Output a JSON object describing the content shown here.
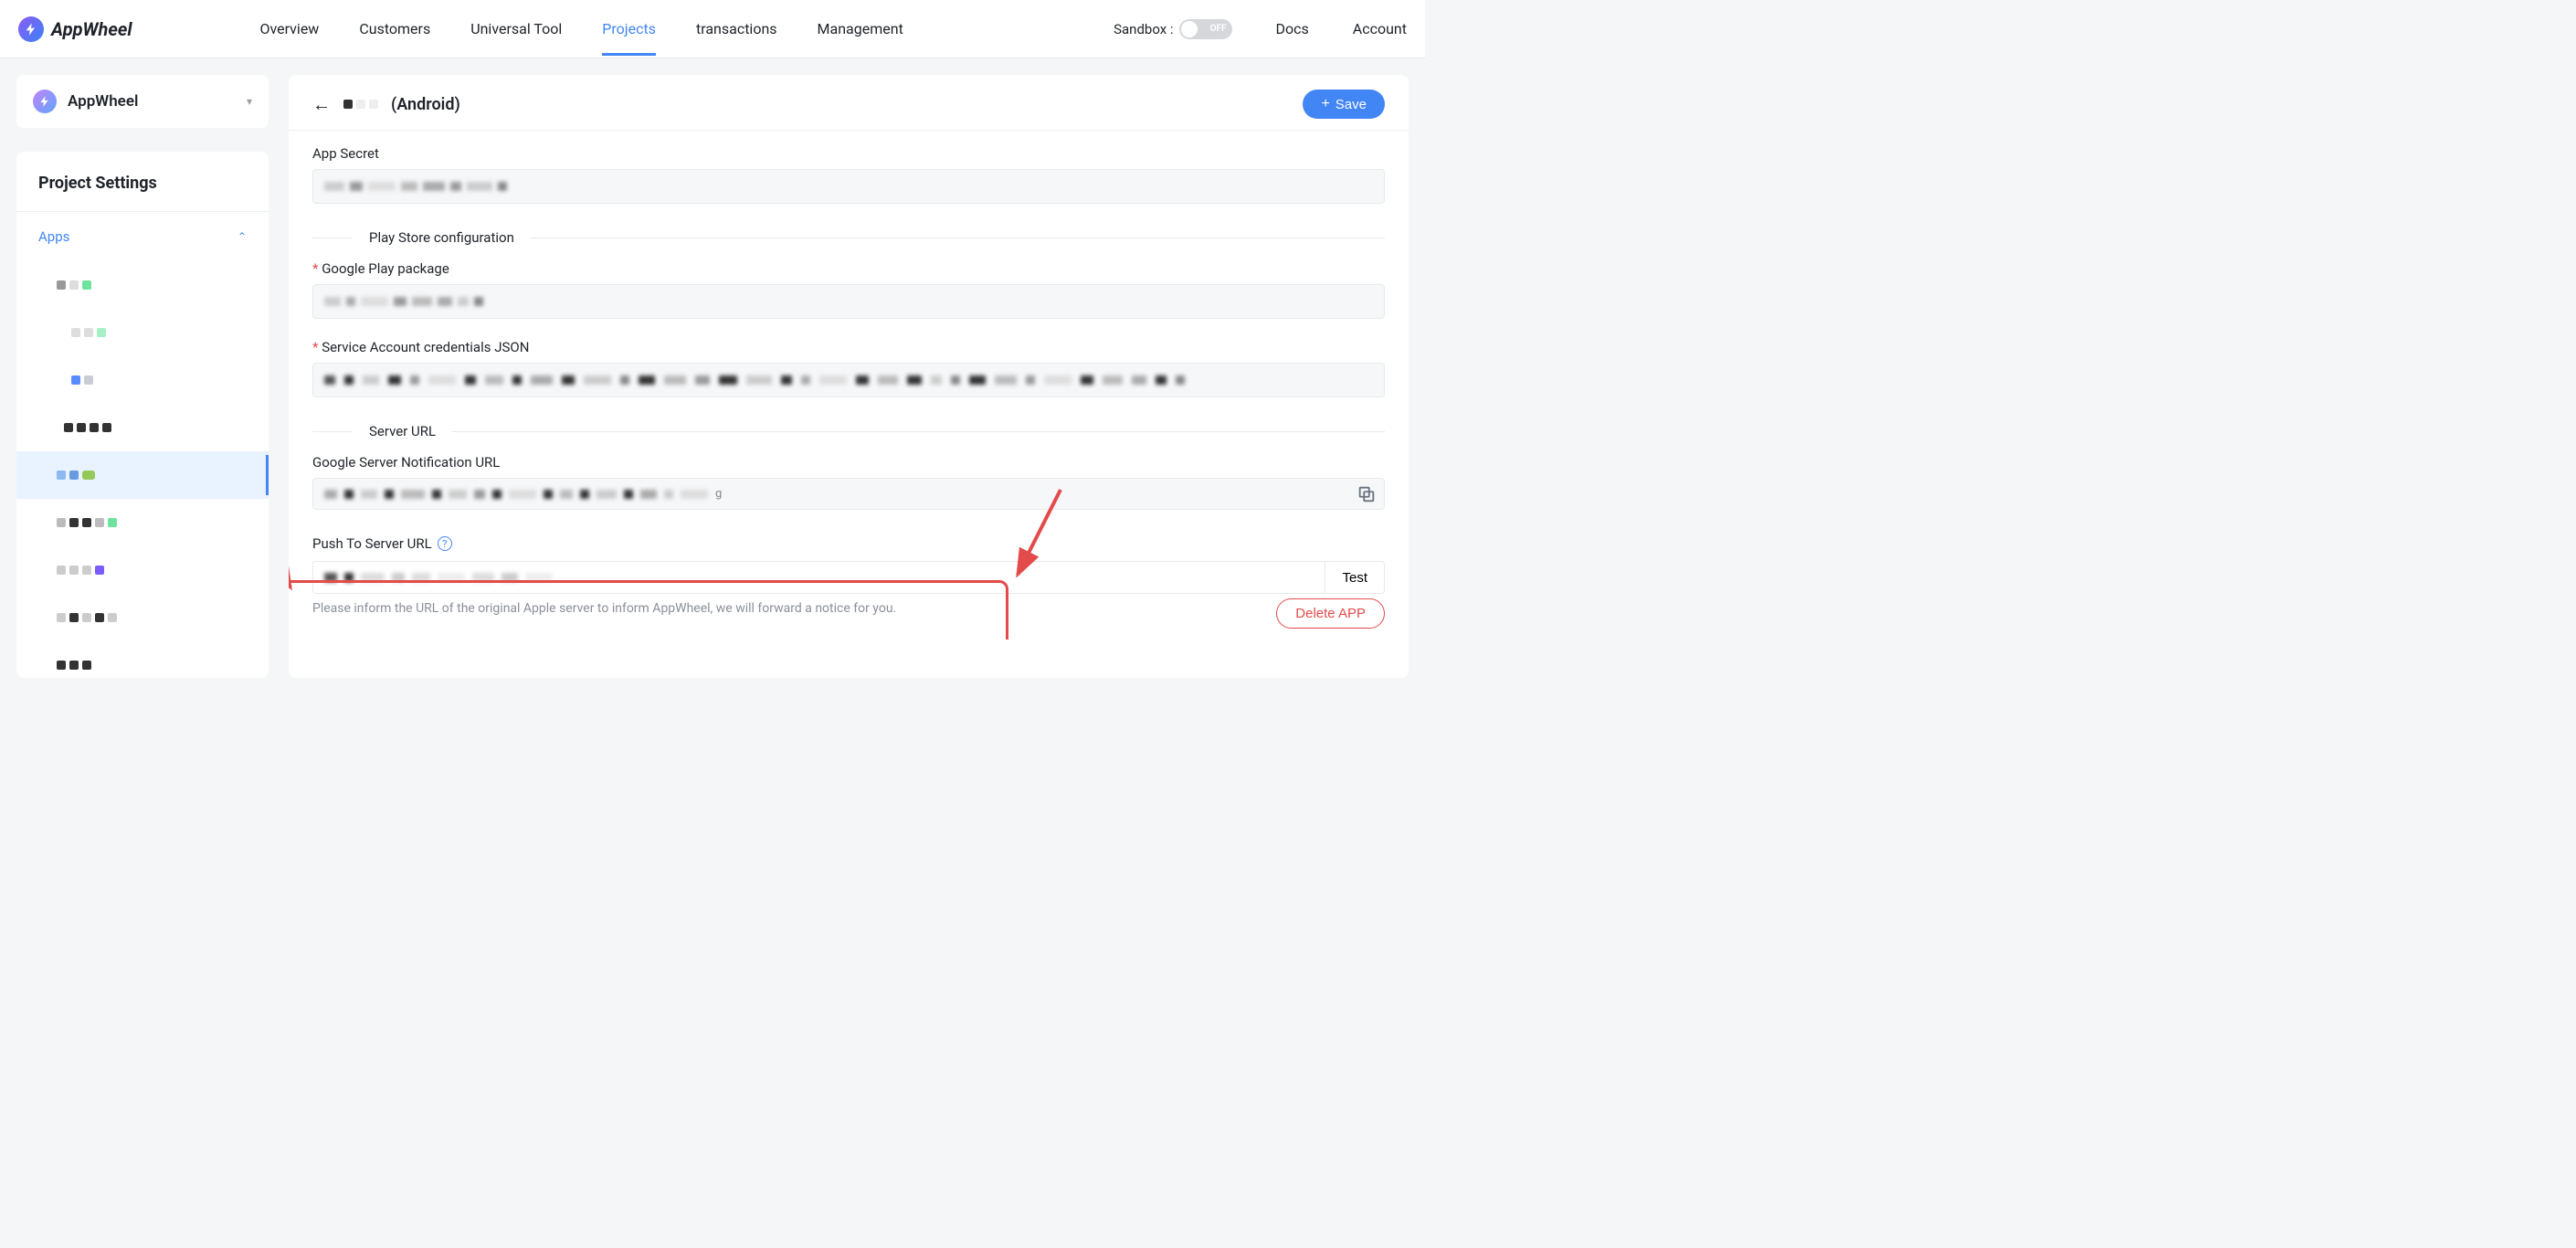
{
  "brand": "AppWheel",
  "nav": {
    "items": [
      {
        "label": "Overview",
        "active": false
      },
      {
        "label": "Customers",
        "active": false
      },
      {
        "label": "Universal Tool",
        "active": false
      },
      {
        "label": "Projects",
        "active": true
      },
      {
        "label": "transactions",
        "active": false
      },
      {
        "label": "Management",
        "active": false
      }
    ]
  },
  "header_right": {
    "sandbox_label": "Sandbox :",
    "sandbox_state": "OFF",
    "docs": "Docs",
    "account": "Account"
  },
  "sidebar": {
    "project_name": "AppWheel",
    "settings_title": "Project Settings",
    "section_apps": "Apps"
  },
  "page": {
    "platform_suffix": "(Android)",
    "save_btn": "Save",
    "labels": {
      "app_secret": "App Secret",
      "play_store_section": "Play Store configuration",
      "google_play_package": "Google Play package",
      "service_account_json": "Service Account credentials JSON",
      "server_url_section": "Server URL",
      "google_notif_url": "Google Server Notification URL",
      "push_url": "Push To Server URL",
      "push_hint": "Please inform the URL of the original Apple server to inform AppWheel, we will forward a notice for you.",
      "test_btn": "Test",
      "delete_btn": "Delete APP"
    },
    "values": {
      "notif_url_visible_char": "g"
    }
  }
}
